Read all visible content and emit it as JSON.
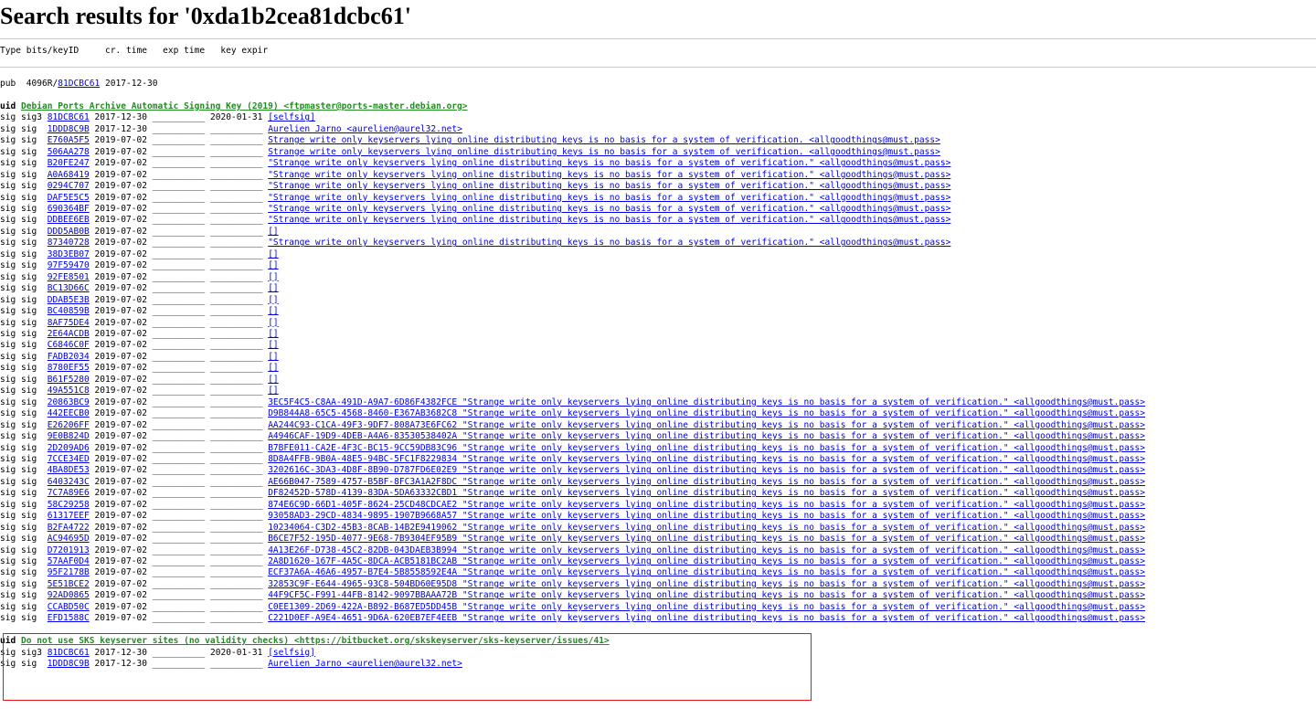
{
  "page": {
    "title": "Search results for '0xda1b2cea81dcbc61'",
    "columns": "Type bits/keyID     cr. time   exp time   key expir"
  },
  "key": {
    "type": "pub",
    "bits": "4096R",
    "keyid": "81DCBC61",
    "created": "2017-12-30"
  },
  "uids": [
    {
      "label": "Debian Ports Archive Automatic Signing Key (2019) <ftpmaster@ports-master.debian.org>",
      "sigs": [
        {
          "type": "sig3",
          "keyid": "81DCBC61",
          "date": "2017-12-30",
          "exp": "2020-01-31",
          "uid": "[selfsig]"
        },
        {
          "type": "sig",
          "keyid": "1DDD8C9B",
          "date": "2017-12-30",
          "exp": "",
          "uid": "Aurelien Jarno <aurelien@aurel32.net>"
        },
        {
          "type": "sig",
          "keyid": "E760A5F5",
          "date": "2019-07-02",
          "exp": "",
          "uid": "Strange write only keyservers lying online distributing keys is no basis for a system of verification. <allgoodthings@must.pass>"
        },
        {
          "type": "sig",
          "keyid": "506AA278",
          "date": "2019-07-02",
          "exp": "",
          "uid": "Strange write only keyservers lying online distributing keys is no basis for a system of verification. <allgoodthings@must.pass>"
        },
        {
          "type": "sig",
          "keyid": "B20FE247",
          "date": "2019-07-02",
          "exp": "",
          "uid": "\"Strange write only keyservers lying online distributing keys is no basis for a system of verification.\" <allgoodthings@must.pass>"
        },
        {
          "type": "sig",
          "keyid": "A0A68419",
          "date": "2019-07-02",
          "exp": "",
          "uid": "\"Strange write only keyservers lying online distributing keys is no basis for a system of verification.\" <allgoodthings@must.pass>"
        },
        {
          "type": "sig",
          "keyid": "0294C707",
          "date": "2019-07-02",
          "exp": "",
          "uid": "\"Strange write only keyservers lying online distributing keys is no basis for a system of verification.\" <allgoodthings@must.pass>"
        },
        {
          "type": "sig",
          "keyid": "DAF5E5C5",
          "date": "2019-07-02",
          "exp": "",
          "uid": "\"Strange write only keyservers lying online distributing keys is no basis for a system of verification.\" <allgoodthings@must.pass>"
        },
        {
          "type": "sig",
          "keyid": "690364BF",
          "date": "2019-07-02",
          "exp": "",
          "uid": "\"Strange write only keyservers lying online distributing keys is no basis for a system of verification.\" <allgoodthings@must.pass>"
        },
        {
          "type": "sig",
          "keyid": "DDBEE6EB",
          "date": "2019-07-02",
          "exp": "",
          "uid": "\"Strange write only keyservers lying online distributing keys is no basis for a system of verification.\" <allgoodthings@must.pass>"
        },
        {
          "type": "sig",
          "keyid": "DDD5AB0B",
          "date": "2019-07-02",
          "exp": "",
          "uid": "[]"
        },
        {
          "type": "sig",
          "keyid": "87340728",
          "date": "2019-07-02",
          "exp": "",
          "uid": "\"Strange write only keyservers lying online distributing keys is no basis for a system of verification.\" <allgoodthings@must.pass>"
        },
        {
          "type": "sig",
          "keyid": "38D3EB07",
          "date": "2019-07-02",
          "exp": "",
          "uid": "[]"
        },
        {
          "type": "sig",
          "keyid": "97F59470",
          "date": "2019-07-02",
          "exp": "",
          "uid": "[]"
        },
        {
          "type": "sig",
          "keyid": "92FE8501",
          "date": "2019-07-02",
          "exp": "",
          "uid": "[]"
        },
        {
          "type": "sig",
          "keyid": "BC13D66C",
          "date": "2019-07-02",
          "exp": "",
          "uid": "[]"
        },
        {
          "type": "sig",
          "keyid": "DDAB5E3B",
          "date": "2019-07-02",
          "exp": "",
          "uid": "[]"
        },
        {
          "type": "sig",
          "keyid": "BC40859B",
          "date": "2019-07-02",
          "exp": "",
          "uid": "[]"
        },
        {
          "type": "sig",
          "keyid": "8AF75DE4",
          "date": "2019-07-02",
          "exp": "",
          "uid": "[]"
        },
        {
          "type": "sig",
          "keyid": "2E64ACDB",
          "date": "2019-07-02",
          "exp": "",
          "uid": "[]"
        },
        {
          "type": "sig",
          "keyid": "C6846C0F",
          "date": "2019-07-02",
          "exp": "",
          "uid": "[]"
        },
        {
          "type": "sig",
          "keyid": "FADB2034",
          "date": "2019-07-02",
          "exp": "",
          "uid": "[]"
        },
        {
          "type": "sig",
          "keyid": "8780EF55",
          "date": "2019-07-02",
          "exp": "",
          "uid": "[]"
        },
        {
          "type": "sig",
          "keyid": "B61F5280",
          "date": "2019-07-02",
          "exp": "",
          "uid": "[]"
        },
        {
          "type": "sig",
          "keyid": "49A551C8",
          "date": "2019-07-02",
          "exp": "",
          "uid": "[]"
        },
        {
          "type": "sig",
          "keyid": "20863BC9",
          "date": "2019-07-02",
          "exp": "",
          "uid": "3EC5F4C5-C8AA-491D-A9A7-6D86F4382FCE \"Strange write only keyservers lying online distributing keys is no basis for a system of verification.\" <allgoodthings@must.pass>"
        },
        {
          "type": "sig",
          "keyid": "442EECB0",
          "date": "2019-07-02",
          "exp": "",
          "uid": "D9B844A8-65C5-4568-8460-E367AB3682C8 \"Strange write only keyservers lying online distributing keys is no basis for a system of verification.\" <allgoodthings@must.pass>"
        },
        {
          "type": "sig",
          "keyid": "E26206FF",
          "date": "2019-07-02",
          "exp": "",
          "uid": "AA244C93-C1CA-49F3-9DF7-808A73E6FC62 \"Strange write only keyservers lying online distributing keys is no basis for a system of verification.\" <allgoodthings@must.pass>"
        },
        {
          "type": "sig",
          "keyid": "9E0B824D",
          "date": "2019-07-02",
          "exp": "",
          "uid": "A4946CAF-19D9-4DEB-A4A6-83530538402A \"Strange write only keyservers lying online distributing keys is no basis for a system of verification.\" <allgoodthings@must.pass>"
        },
        {
          "type": "sig",
          "keyid": "2D209AD6",
          "date": "2019-07-02",
          "exp": "",
          "uid": "B7BFE011-CA2E-4F3C-BC15-9CC59DB83C96 \"Strange write only keyservers lying online distributing keys is no basis for a system of verification.\" <allgoodthings@must.pass>"
        },
        {
          "type": "sig",
          "keyid": "7CCE34ED",
          "date": "2019-07-02",
          "exp": "",
          "uid": "8D8A4FFB-9B0A-48E5-94BC-5FC1F8229834 \"Strange write only keyservers lying online distributing keys is no basis for a system of verification.\" <allgoodthings@must.pass>"
        },
        {
          "type": "sig",
          "keyid": "4BA8DE53",
          "date": "2019-07-02",
          "exp": "",
          "uid": "3202616C-3DA3-4D8F-8B90-D787FD6E02E9 \"Strange write only keyservers lying online distributing keys is no basis for a system of verification.\" <allgoodthings@must.pass>"
        },
        {
          "type": "sig",
          "keyid": "6403243C",
          "date": "2019-07-02",
          "exp": "",
          "uid": "AE66B047-7589-4757-B5BF-8FC3A1A2F8DC \"Strange write only keyservers lying online distributing keys is no basis for a system of verification.\" <allgoodthings@must.pass>"
        },
        {
          "type": "sig",
          "keyid": "7C7A89E6",
          "date": "2019-07-02",
          "exp": "",
          "uid": "DF82452D-578D-4139-83DA-5DA63332CBD1 \"Strange write only keyservers lying online distributing keys is no basis for a system of verification.\" <allgoodthings@must.pass>"
        },
        {
          "type": "sig",
          "keyid": "58C29258",
          "date": "2019-07-02",
          "exp": "",
          "uid": "874E6C9D-66D1-405F-8624-25CD48CDCAE2 \"Strange write only keyservers lying online distributing keys is no basis for a system of verification.\" <allgoodthings@must.pass>"
        },
        {
          "type": "sig",
          "keyid": "61317EEF",
          "date": "2019-07-02",
          "exp": "",
          "uid": "93058AD3-29CD-4834-9895-1907B9668A57 \"Strange write only keyservers lying online distributing keys is no basis for a system of verification.\" <allgoodthings@must.pass>"
        },
        {
          "type": "sig",
          "keyid": "B2FA4722",
          "date": "2019-07-02",
          "exp": "",
          "uid": "10234064-C3D2-45B3-8CAB-14B2E9419062 \"Strange write only keyservers lying online distributing keys is no basis for a system of verification.\" <allgoodthings@must.pass>"
        },
        {
          "type": "sig",
          "keyid": "AC94695D",
          "date": "2019-07-02",
          "exp": "",
          "uid": "B6CE7F52-195D-4077-9E68-7B9304EF95B9 \"Strange write only keyservers lying online distributing keys is no basis for a system of verification.\" <allgoodthings@must.pass>"
        },
        {
          "type": "sig",
          "keyid": "D7201913",
          "date": "2019-07-02",
          "exp": "",
          "uid": "4A13E26F-D738-45C2-82DB-043DAEB3B994 \"Strange write only keyservers lying online distributing keys is no basis for a system of verification.\" <allgoodthings@must.pass>"
        },
        {
          "type": "sig",
          "keyid": "57AAF0D4",
          "date": "2019-07-02",
          "exp": "",
          "uid": "2A8D1620-167F-4A5C-8DCA-ACB5181BC2AB \"Strange write only keyservers lying online distributing keys is no basis for a system of verification.\" <allgoodthings@must.pass>"
        },
        {
          "type": "sig",
          "keyid": "95F2178B",
          "date": "2019-07-02",
          "exp": "",
          "uid": "ECF37A6A-46A6-4957-B7E4-5B8558592E4A \"Strange write only keyservers lying online distributing keys is no basis for a system of verification.\" <allgoodthings@must.pass>"
        },
        {
          "type": "sig",
          "keyid": "5E51BCE2",
          "date": "2019-07-02",
          "exp": "",
          "uid": "32853C9F-E644-4965-93C8-504BD60E95D8 \"Strange write only keyservers lying online distributing keys is no basis for a system of verification.\" <allgoodthings@must.pass>"
        },
        {
          "type": "sig",
          "keyid": "92AD0865",
          "date": "2019-07-02",
          "exp": "",
          "uid": "44F9CF5C-F991-44FB-8142-9097BBAAA72B \"Strange write only keyservers lying online distributing keys is no basis for a system of verification.\" <allgoodthings@must.pass>"
        },
        {
          "type": "sig",
          "keyid": "CCABD50C",
          "date": "2019-07-02",
          "exp": "",
          "uid": "C0EE1309-2D69-422A-B892-B687ED5DD45B \"Strange write only keyservers lying online distributing keys is no basis for a system of verification.\" <allgoodthings@must.pass>"
        },
        {
          "type": "sig",
          "keyid": "EFD1588C",
          "date": "2019-07-02",
          "exp": "",
          "uid": "C221D0EF-A9E4-4651-9D6A-620EB7EF4EEB \"Strange write only keyservers lying online distributing keys is no basis for a system of verification.\" <allgoodthings@must.pass>"
        }
      ]
    },
    {
      "label": "Do not use SKS keyserver sites (no validity checks) <https://bitbucket.org/skskeyserver/sks-keyserver/issues/41>",
      "sigs": [
        {
          "type": "sig3",
          "keyid": "81DCBC61",
          "date": "2017-12-30",
          "exp": "2020-01-31",
          "uid": "[selfsig]"
        },
        {
          "type": "sig",
          "keyid": "1DDD8C9B",
          "date": "2017-12-30",
          "exp": "",
          "uid": "Aurelien Jarno <aurelien@aurel32.net>"
        }
      ]
    }
  ],
  "labels": {
    "uid": "uid",
    "sig": "sig",
    "blank": "__________"
  }
}
